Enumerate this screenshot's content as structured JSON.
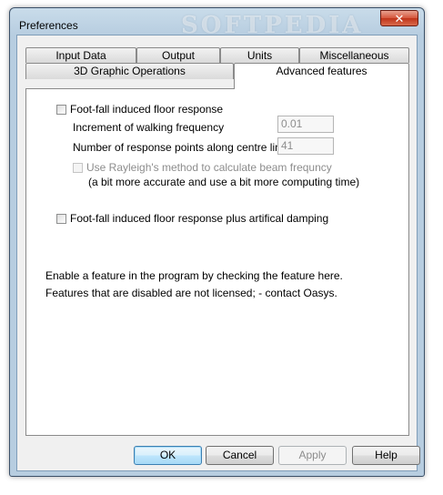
{
  "window": {
    "title": "Preferences",
    "watermark": "SOFTPEDIA",
    "close_glyph": "✕"
  },
  "tabs": {
    "row_back": [
      "Input Data",
      "Output",
      "Units",
      "Miscellaneous"
    ],
    "row_front": [
      "3D Graphic Operations",
      "Advanced features"
    ],
    "active": "Advanced features"
  },
  "panel": {
    "footfall": {
      "label": "Foot-fall induced floor response",
      "checked": false
    },
    "increment": {
      "label": "Increment of walking frequency",
      "value": "0.01"
    },
    "points": {
      "label": "Number of response points along centre line",
      "value": "41"
    },
    "rayleigh": {
      "label": "Use Rayleigh's method to calculate beam frequncy",
      "note": "(a bit more accurate and use a bit more computing time)",
      "checked": false
    },
    "footfall_damping": {
      "label": "Foot-fall induced floor response plus artifical damping",
      "checked": false
    },
    "info_line1": "Enable a feature in the program by checking the feature here.",
    "info_line2": "Features that are disabled are not licensed;  - contact Oasys."
  },
  "buttons": {
    "ok": "OK",
    "cancel": "Cancel",
    "apply": "Apply",
    "help": "Help"
  }
}
